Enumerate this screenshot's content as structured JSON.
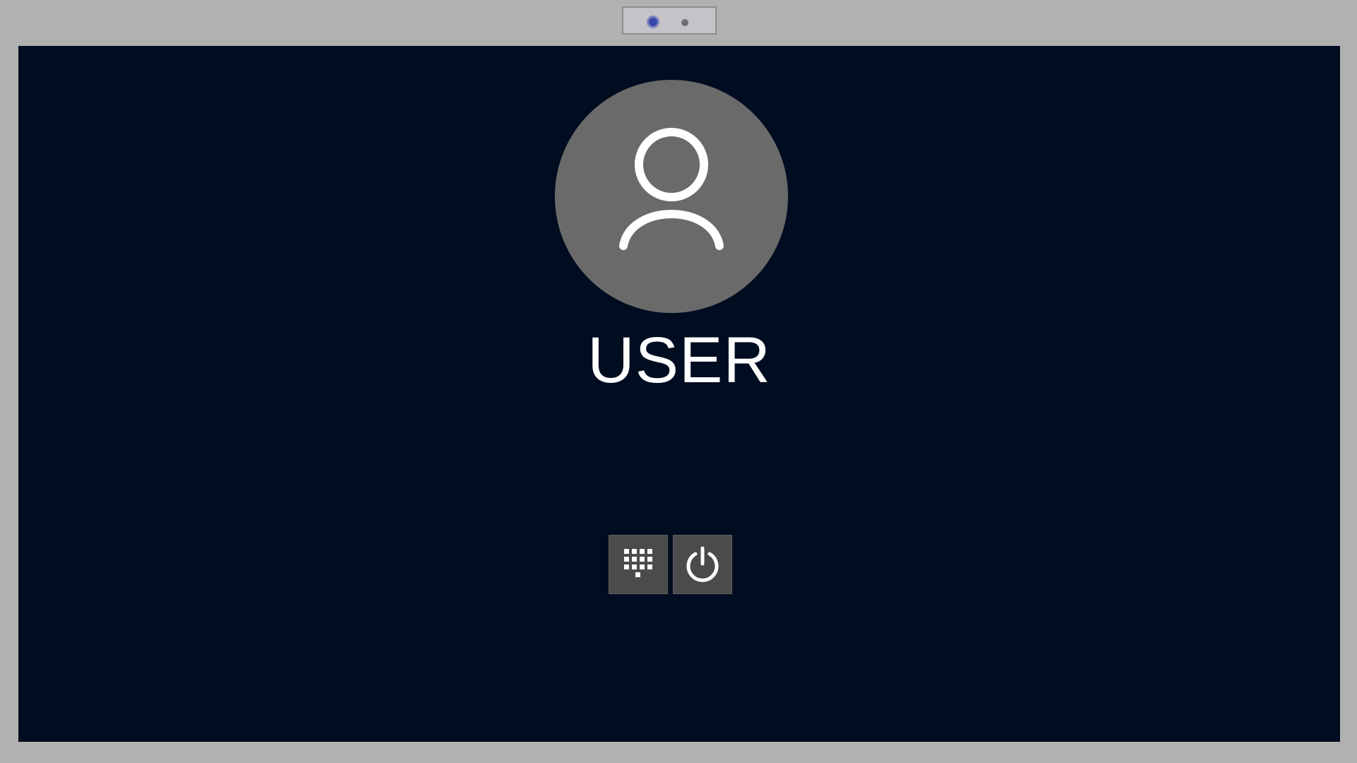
{
  "login": {
    "username": "USER"
  },
  "icons": {
    "avatar": "user-avatar-icon",
    "keypad": "keypad-icon",
    "power": "power-icon"
  },
  "colors": {
    "screen_background": "#000c20",
    "avatar_circle": "#6a6a6a",
    "button_background": "#4b4b4b",
    "text": "#ffffff",
    "bezel": "#b1b1b1"
  }
}
